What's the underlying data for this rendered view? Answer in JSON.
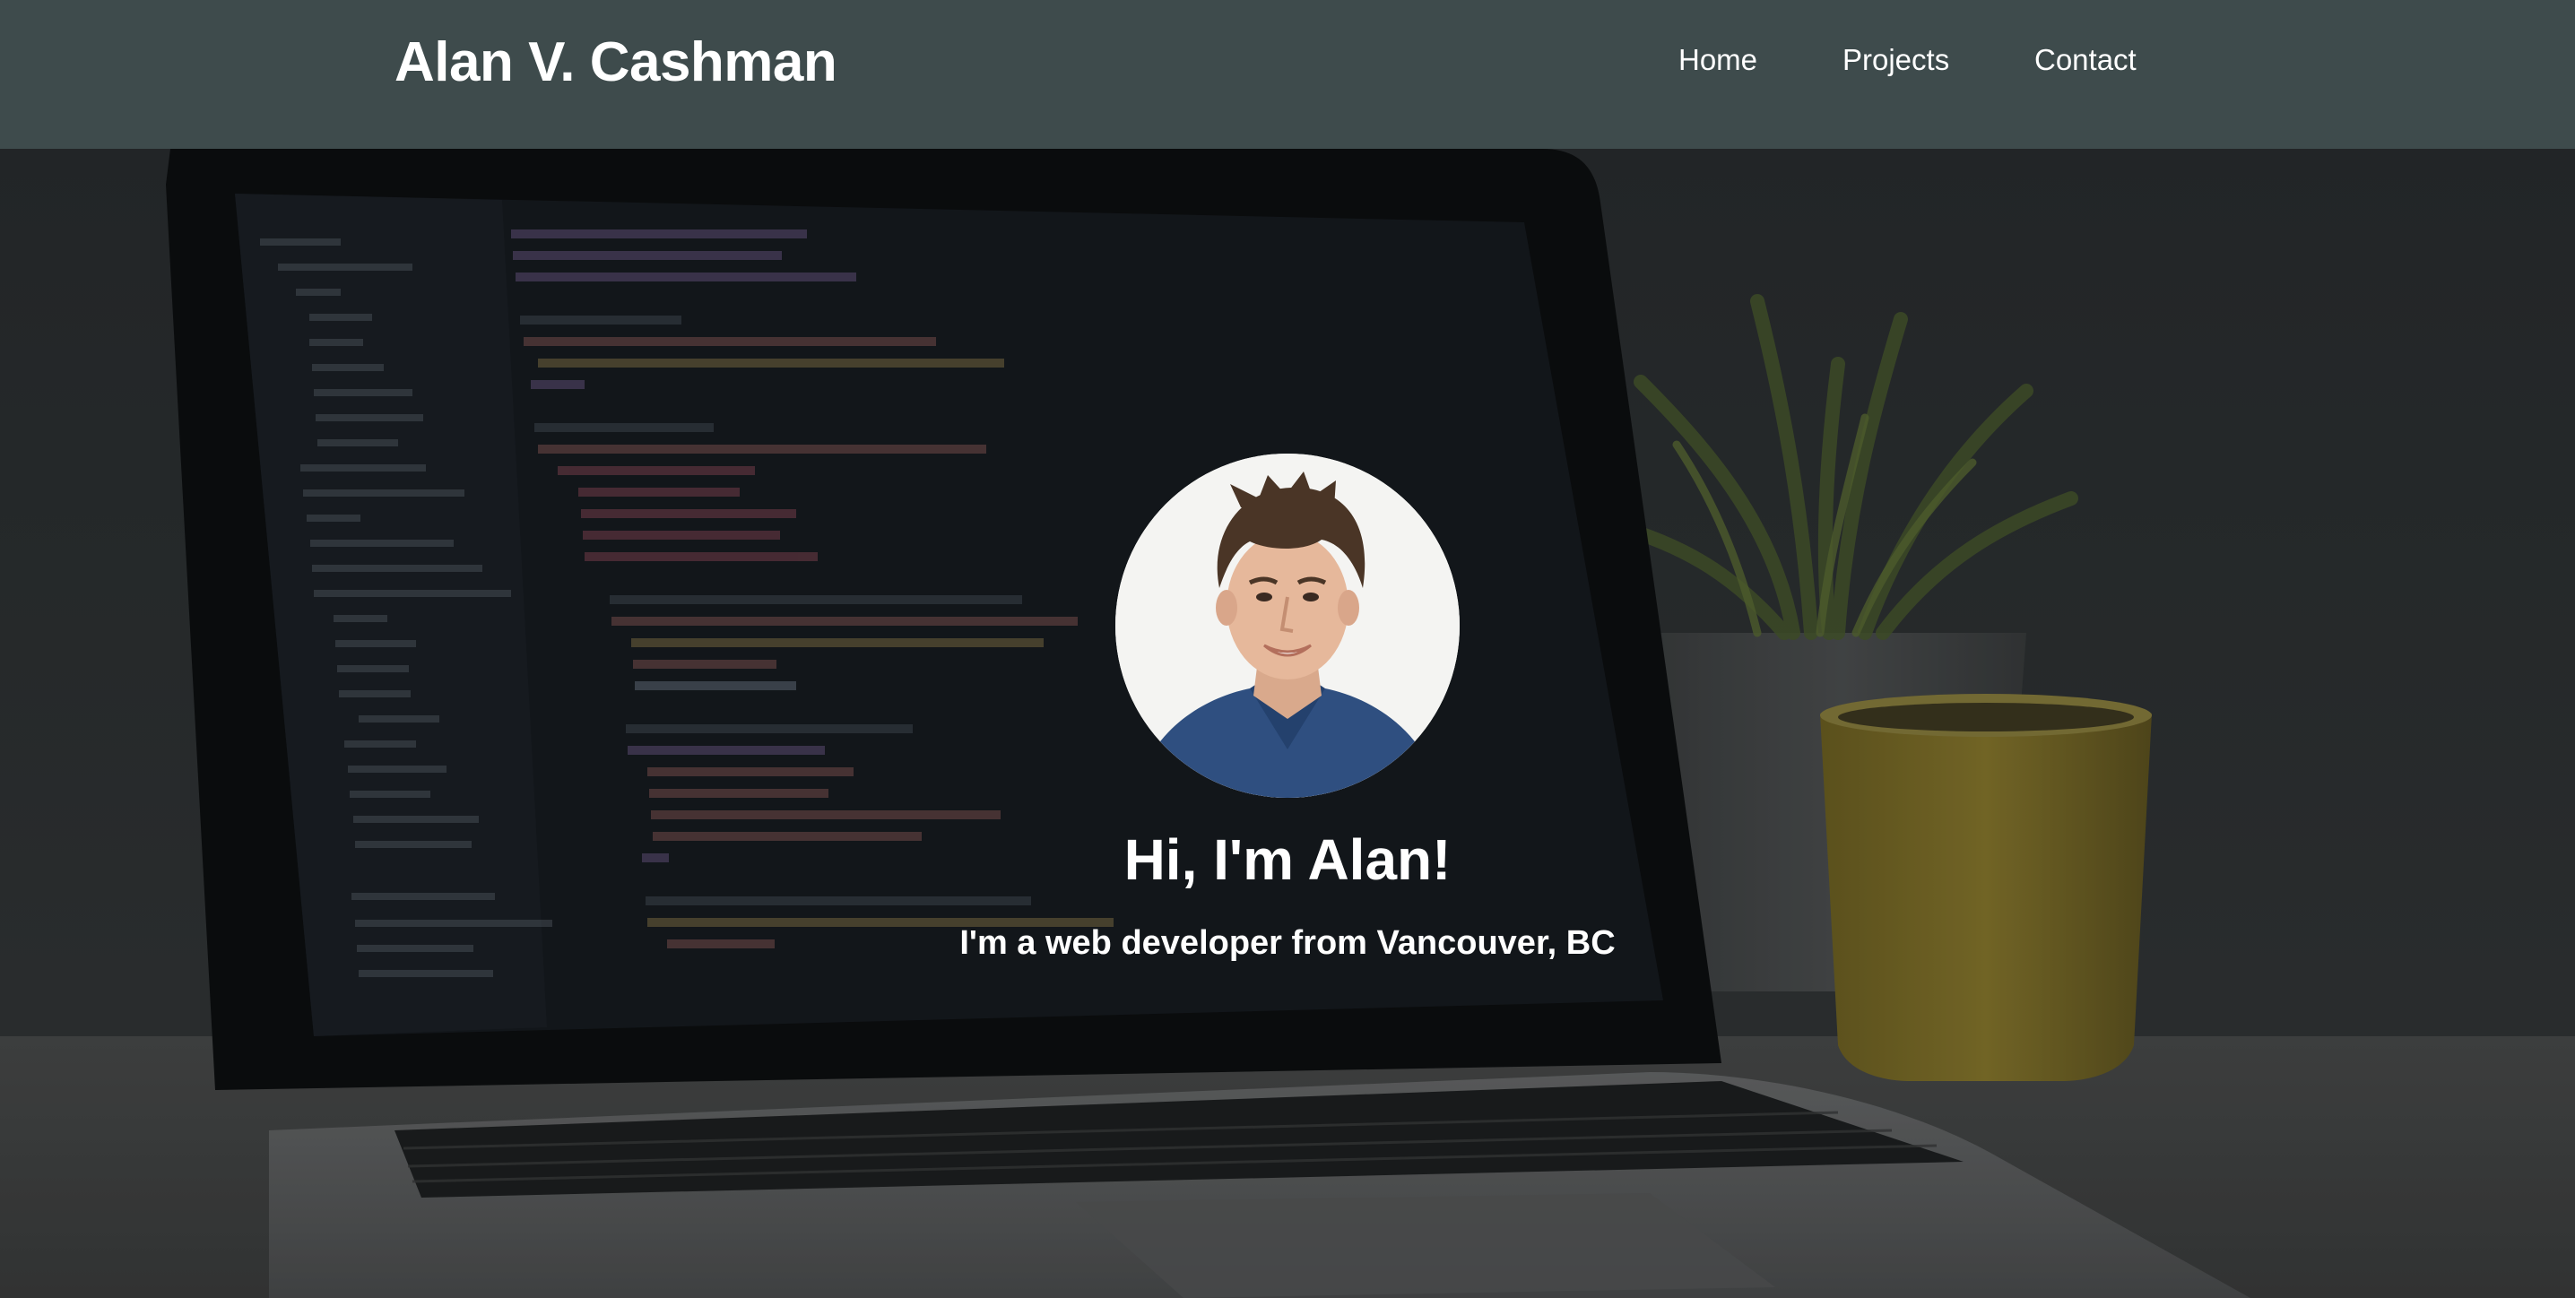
{
  "header": {
    "brand": "Alan V. Cashman",
    "nav": [
      {
        "label": "Home"
      },
      {
        "label": "Projects"
      },
      {
        "label": "Contact"
      }
    ]
  },
  "hero": {
    "title": "Hi, I'm Alan!",
    "subtitle": "I'm a web developer from Vancouver, BC",
    "background": "laptop-with-code-editor-and-plant-photo",
    "avatar": "profile-photo"
  },
  "colors": {
    "header_bg": "#3e4b4c",
    "text": "#ffffff"
  }
}
